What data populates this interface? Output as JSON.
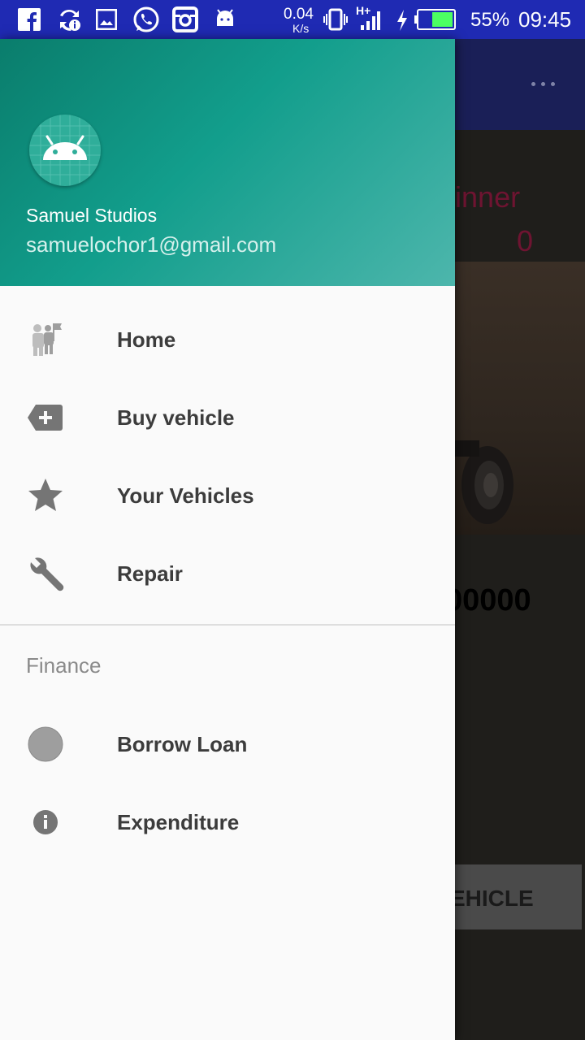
{
  "status_bar": {
    "net_speed_value": "0.04",
    "net_speed_unit": "K/s",
    "network_type": "H+",
    "battery_percent": "55%",
    "time": "09:45"
  },
  "background_app": {
    "level_text": "ginner",
    "level_value": "0",
    "money_text": "00000",
    "button_text": "EHICLE"
  },
  "drawer": {
    "header": {
      "name": "Samuel Studios",
      "email": "samuelochor1@gmail.com"
    },
    "items": [
      {
        "label": "Home",
        "icon": "home-figure-icon"
      },
      {
        "label": "Buy vehicle",
        "icon": "add-tag-icon"
      },
      {
        "label": "Your Vehicles",
        "icon": "star-icon"
      },
      {
        "label": "Repair",
        "icon": "wrench-icon"
      }
    ],
    "section": {
      "title": "Finance",
      "items": [
        {
          "label": "Borrow Loan",
          "icon": "circle-icon"
        },
        {
          "label": "Expenditure",
          "icon": "info-icon"
        }
      ]
    }
  },
  "colors": {
    "status_bar": "#1f2ab3",
    "drawer_header_start": "#0a7d6c",
    "drawer_header_end": "#4db6ac",
    "menu_text": "#3c3c3c",
    "menu_icon": "#8a8a8a"
  }
}
